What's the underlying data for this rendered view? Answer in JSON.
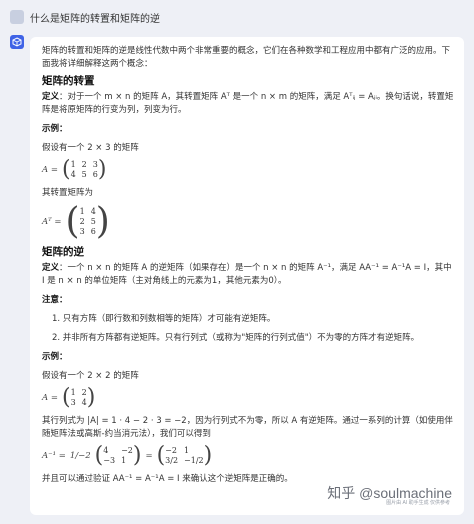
{
  "question": "什么是矩阵的转置和矩阵的逆",
  "intro": "矩阵的转置和矩阵的逆是线性代数中两个非常重要的概念，它们在各种数学和工程应用中都有广泛的应用。下面我将详细解释这两个概念：",
  "section1": {
    "title": "矩阵的转置",
    "def_label": "定义",
    "def_text": "：对于一个 m × n 的矩阵 A，其转置矩阵 Aᵀ 是一个 n × m 的矩阵，满足 Aᵀᵢⱼ = Aⱼᵢ。换句话说，转置矩阵是将原矩阵的行变为列，列变为行。",
    "example_label": "示例：",
    "example_text": "假设有一个 2 × 3 的矩阵",
    "matrix_label": "A =",
    "matrix": [
      "1",
      "2",
      "3",
      "4",
      "5",
      "6"
    ],
    "transpose_text": "其转置矩阵为",
    "transpose_label": "Aᵀ =",
    "transpose": [
      "1",
      "4",
      "2",
      "5",
      "3",
      "6"
    ]
  },
  "section2": {
    "title": "矩阵的逆",
    "def_label": "定义",
    "def_text": "：一个 n × n 的矩阵 A 的逆矩阵（如果存在）是一个 n × n 的矩阵 A⁻¹，满足 AA⁻¹ = A⁻¹A = I，其中 I 是 n × n 的单位矩阵（主对角线上的元素为1，其他元素为0）。",
    "note_label": "注意：",
    "notes": [
      "1. 只有方阵（即行数和列数相等的矩阵）才可能有逆矩阵。",
      "2. 并非所有方阵都有逆矩阵。只有行列式（或称为\"矩阵的行列式值\"）不为零的方阵才有逆矩阵。"
    ],
    "example_label": "示例：",
    "example_text": "假设有一个 2 × 2 的矩阵",
    "matrix_label": "A =",
    "matrix": [
      "1",
      "2",
      "3",
      "4"
    ],
    "det_text": "其行列式为 |A| = 1 · 4 − 2 · 3 = −2，因为行列式不为零，所以 A 有逆矩阵。通过一系列的计算（如使用伴随矩阵法或高斯-约当消元法），我们可以得到",
    "inverse_label": "A⁻¹ =",
    "inverse_factor": "1/−2",
    "adj": [
      "4",
      "−2",
      "−3",
      "1"
    ],
    "equals": "=",
    "inverse": [
      "−2",
      "1",
      "3/2",
      "−1/2"
    ],
    "verify_text": "并且可以通过验证 AA⁻¹ = A⁻¹A = I 来确认这个逆矩阵是正确的。"
  },
  "watermark": "知乎 @soulmachine",
  "watermark_sub": "图片由 AI 助手生成 仅供参考"
}
